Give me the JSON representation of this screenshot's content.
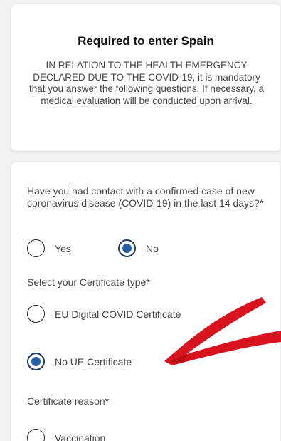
{
  "header": {
    "title": "Required to enter Spain",
    "notice": "IN RELATION TO THE HEALTH EMERGENCY DECLARED DUE TO THE COVID-19, it is mandatory that you answer the following questions. If necessary, a medical evaluation will be conducted upon arrival."
  },
  "form": {
    "contact_question": "Have you had contact with a confirmed case of new coronavirus disease (COVID-19) in the last 14 days?*",
    "contact_options": [
      {
        "label": "Yes",
        "selected": false
      },
      {
        "label": "No",
        "selected": true
      }
    ],
    "certificate_type_label": "Select your Certificate type*",
    "certificate_type_options": [
      {
        "label": "EU Digital COVID Certificate",
        "selected": false
      },
      {
        "label": "No UE Certificate",
        "selected": true
      }
    ],
    "certificate_reason_label": "Certificate reason*",
    "certificate_reason_options": [
      {
        "label": "Vaccination",
        "selected": false
      }
    ]
  },
  "colors": {
    "radio_selected": "#1f5fa6",
    "annotation_arrow": "#d9131d"
  },
  "icons": {
    "annotation": "red-arrow-icon"
  }
}
